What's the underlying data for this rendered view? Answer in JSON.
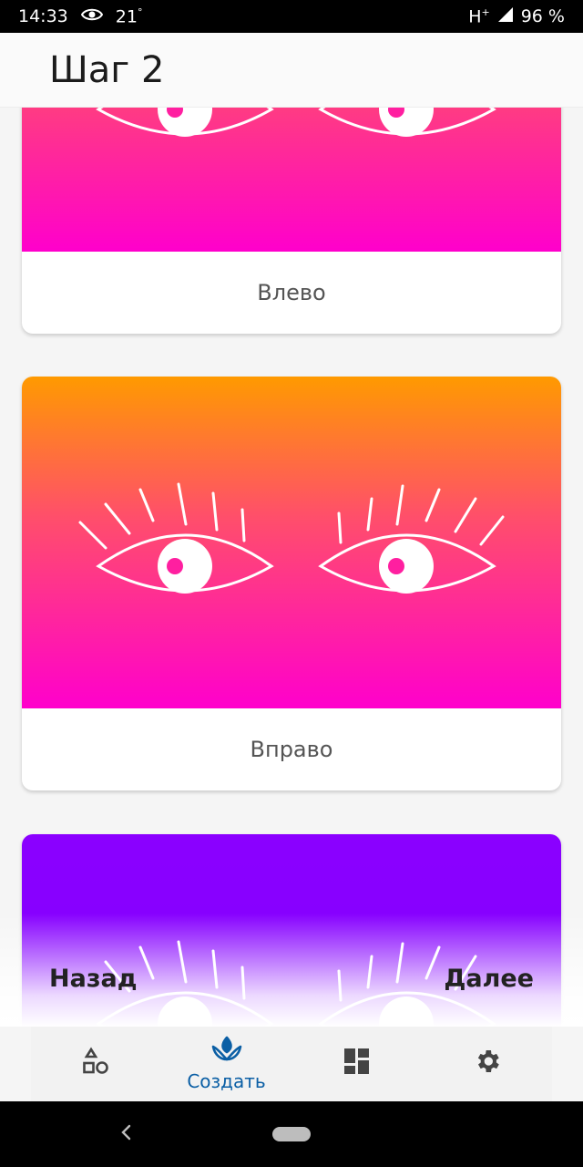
{
  "status_bar": {
    "time": "14:33",
    "temperature": "21",
    "temp_unit": "°",
    "network": "H",
    "network_plus": "+",
    "battery": "96 %"
  },
  "header": {
    "title": "Шаг 2"
  },
  "cards": [
    {
      "label": "Влево",
      "gradient": [
        "#ff9a00",
        "#ff4f6a",
        "#ff00cc"
      ]
    },
    {
      "label": "Вправо",
      "gradient": [
        "#ff9a00",
        "#ff4f6a",
        "#ff00cc"
      ]
    },
    {
      "label": "",
      "gradient": [
        "#8b00ff",
        "#7a00ff"
      ]
    }
  ],
  "step_nav": {
    "back_label": "Назад",
    "next_label": "Далее"
  },
  "bottom_nav": {
    "items": [
      {
        "icon": "shapes-icon",
        "label": ""
      },
      {
        "icon": "sprout-icon",
        "label": "Создать",
        "active": true
      },
      {
        "icon": "dashboard-icon",
        "label": ""
      },
      {
        "icon": "gear-icon",
        "label": ""
      }
    ]
  },
  "colors": {
    "accent": "#0b5fa5",
    "eye_pupil": "#ff1fa0"
  }
}
